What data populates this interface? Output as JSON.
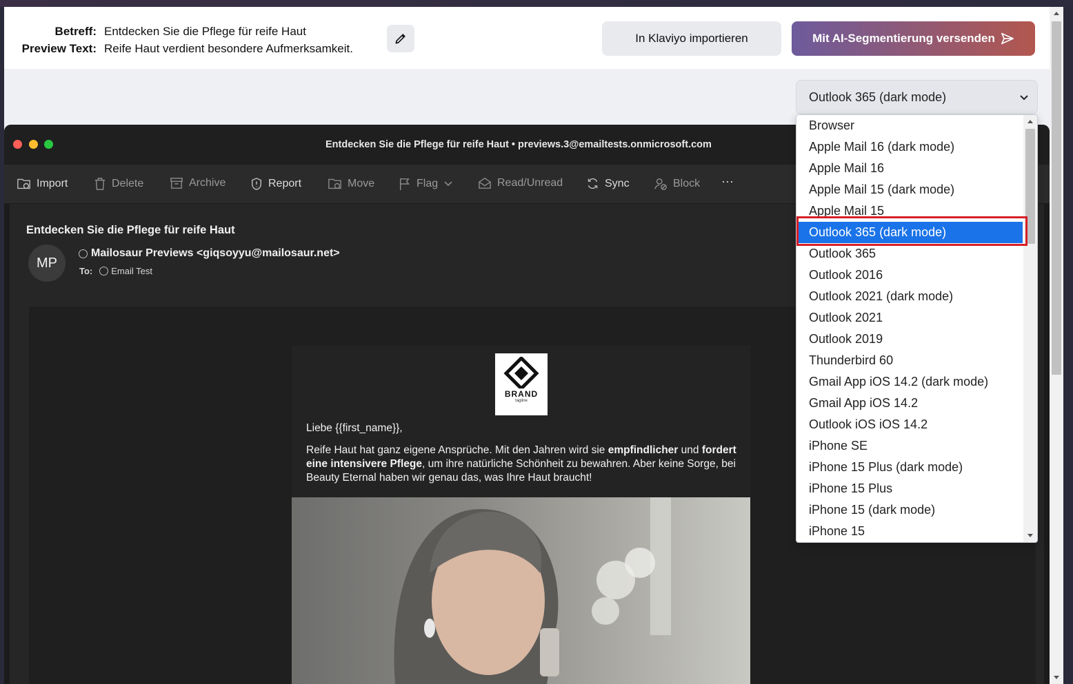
{
  "header": {
    "subject_label": "Betreff:",
    "subject_value": "Entdecken Sie die Pflege für reife Haut",
    "preview_label": "Preview Text:",
    "preview_value": "Reife Haut verdient besondere Aufmerksamkeit.",
    "klaviyo_button": "In Klaviyo importieren",
    "ai_button": "Mit AI-Segmentierung versenden"
  },
  "client_select": {
    "selected": "Outlook 365 (dark mode)",
    "options": [
      "Browser",
      "Apple Mail 16 (dark mode)",
      "Apple Mail 16",
      "Apple Mail 15 (dark mode)",
      "Apple Mail 15",
      "Outlook 365 (dark mode)",
      "Outlook 365",
      "Outlook 2016",
      "Outlook 2021 (dark mode)",
      "Outlook 2021",
      "Outlook 2019",
      "Thunderbird 60",
      "Gmail App iOS 14.2 (dark mode)",
      "Gmail App iOS 14.2",
      "Outlook iOS iOS 14.2",
      "iPhone SE",
      "iPhone 15 Plus (dark mode)",
      "iPhone 15 Plus",
      "iPhone 15 (dark mode)",
      "iPhone 15"
    ]
  },
  "mail_window": {
    "title": "Entdecken Sie die Pflege für reife Haut • previews.3@emailtests.onmicrosoft.com",
    "toolbar": [
      "Import",
      "Delete",
      "Archive",
      "Report",
      "Move",
      "Flag",
      "Read/Unread",
      "Sync",
      "Block",
      "···"
    ],
    "subject": "Entdecken Sie die Pflege für reife Haut",
    "avatar": "MP",
    "sender": "Mailosaur Previews <giqsoyyu@mailosaur.net>",
    "to_label": "To:",
    "to_value": "Email Test"
  },
  "email": {
    "logo_text": "BRAND",
    "logo_tagline": "tagline",
    "greeting": "Liebe {{first_name}},",
    "p1_a": "Reife Haut hat ganz eigene Ansprüche. Mit den Jahren wird sie ",
    "p1_b": "empfindlicher",
    "p1_c": " und ",
    "p1_d": "fordert eine intensivere Pflege",
    "p1_e": ", um ihre natürliche Schönheit zu bewahren. Aber keine Sorge, bei Beauty Eternal haben wir genau das, was Ihre Haut braucht!"
  },
  "colors": {
    "accent_start": "#6d5b9c",
    "accent_end": "#b2574f",
    "selected_option": "#1a73e8",
    "highlight_box": "#d61f26"
  }
}
